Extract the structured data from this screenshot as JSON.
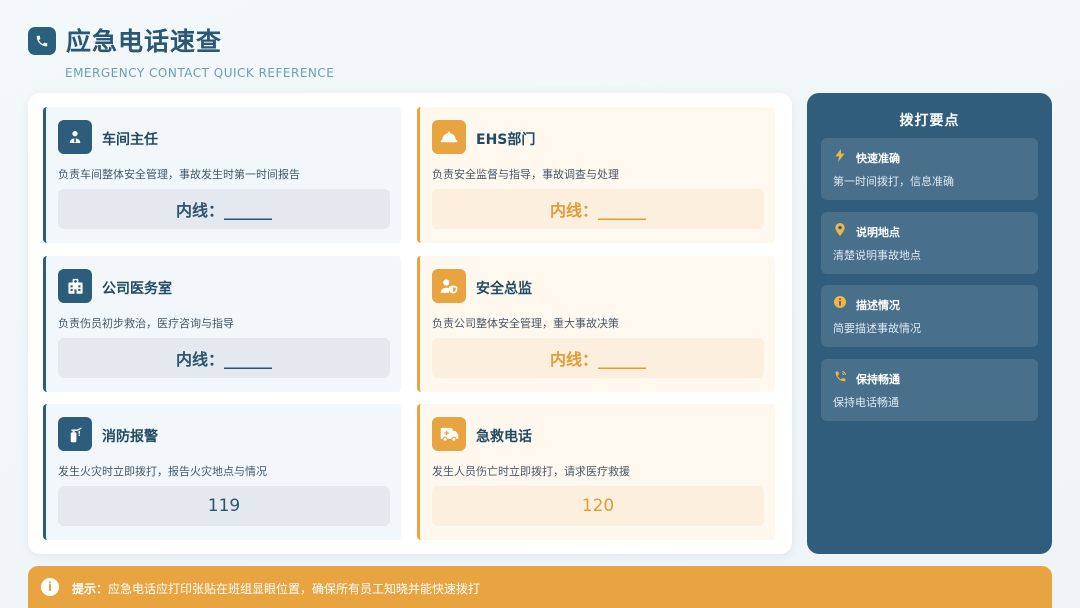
{
  "header": {
    "title": "应急电话速查",
    "subtitle": "EMERGENCY CONTACT QUICK REFERENCE",
    "icon": "phone-icon"
  },
  "cards": [
    {
      "title": "车间主任",
      "desc": "负责车间整体安全管理，事故发生时第一时间报告",
      "number": "内线：______",
      "icon": "manager-icon",
      "theme": "blue"
    },
    {
      "title": "EHS部门",
      "desc": "负责安全监督与指导，事故调查与处理",
      "number": "内线：______",
      "icon": "hard-hat-icon",
      "theme": "orange"
    },
    {
      "title": "公司医务室",
      "desc": "负责伤员初步救治，医疗咨询与指导",
      "number": "内线：______",
      "icon": "hospital-icon",
      "theme": "blue"
    },
    {
      "title": "安全总监",
      "desc": "负责公司整体安全管理，重大事故决策",
      "number": "内线：______",
      "icon": "user-shield-icon",
      "theme": "orange"
    },
    {
      "title": "消防报警",
      "desc": "发生火灾时立即拨打，报告火灾地点与情况",
      "number": "119",
      "icon": "fire-extinguisher-icon",
      "theme": "blue"
    },
    {
      "title": "急救电话",
      "desc": "发生人员伤亡时立即拨打，请求医疗救援",
      "number": "120",
      "icon": "ambulance-icon",
      "theme": "orange"
    }
  ],
  "side": {
    "title": "拨打要点",
    "tips": [
      {
        "title": "快速准确",
        "desc": "第一时间拨打，信息准确",
        "icon": "bolt-icon"
      },
      {
        "title": "说明地点",
        "desc": "清楚说明事故地点",
        "icon": "map-pin-icon"
      },
      {
        "title": "描述情况",
        "desc": "简要描述事故情况",
        "icon": "info-icon"
      },
      {
        "title": "保持畅通",
        "desc": "保持电话畅通",
        "icon": "phone-volume-icon"
      }
    ]
  },
  "footer": {
    "label": "提示：",
    "text": "应急电话应打印张贴在班组显眼位置，确保所有员工知晓并能快速拨打",
    "icon_glyph": "i"
  },
  "colors": {
    "primary": "#2c5e7c",
    "accent": "#e8a440"
  }
}
